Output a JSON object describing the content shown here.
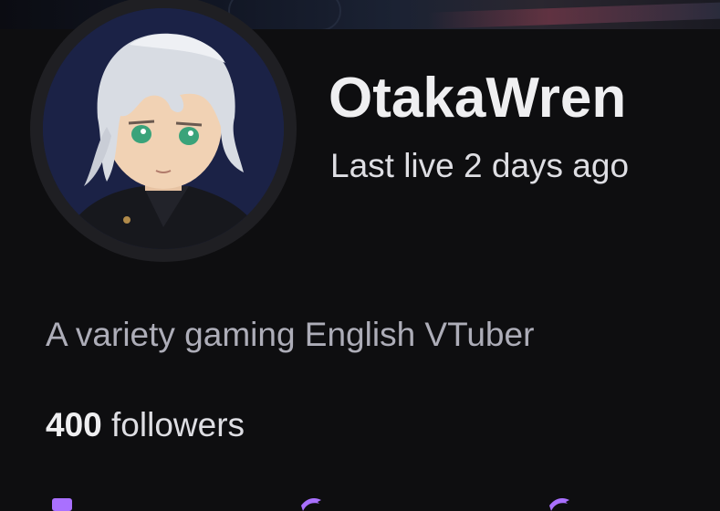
{
  "profile": {
    "username": "OtakaWren",
    "last_live": "Last live 2 days ago",
    "bio": "A variety gaming English VTuber",
    "followers": {
      "count": "400",
      "label": "followers"
    }
  },
  "icons": {
    "social_links": [
      "social-link-icon",
      "twitter-icon",
      "twitter-icon"
    ]
  },
  "colors": {
    "background": "#0e0e10",
    "text_primary": "#efeff1",
    "text_secondary": "#adadb8",
    "accent": "#a970ff"
  }
}
